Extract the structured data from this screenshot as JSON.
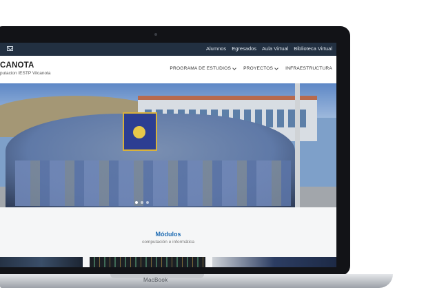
{
  "device": {
    "brand_label": "MacBook"
  },
  "topbar": {
    "links": [
      "Alumnos",
      "Egresados",
      "Aula Virtual",
      "Biblioteca Virtual"
    ]
  },
  "header": {
    "title": "CANOTA",
    "subtitle": "putacion IESTP Vilcanota",
    "nav": [
      {
        "label": "PROGRAMA DE ESTUDIOS",
        "has_dropdown": true
      },
      {
        "label": "PROYECTOS",
        "has_dropdown": true
      },
      {
        "label": "INFRAESTRUCTURA",
        "has_dropdown": false
      }
    ]
  },
  "hero": {
    "slide_indicators": 3,
    "active_slide": 1
  },
  "modules": {
    "title": "Módulos",
    "subtitle": "computación e informática"
  },
  "colors": {
    "topbar": "#223041",
    "accent": "#1f6cb3",
    "frame": "#121317"
  }
}
